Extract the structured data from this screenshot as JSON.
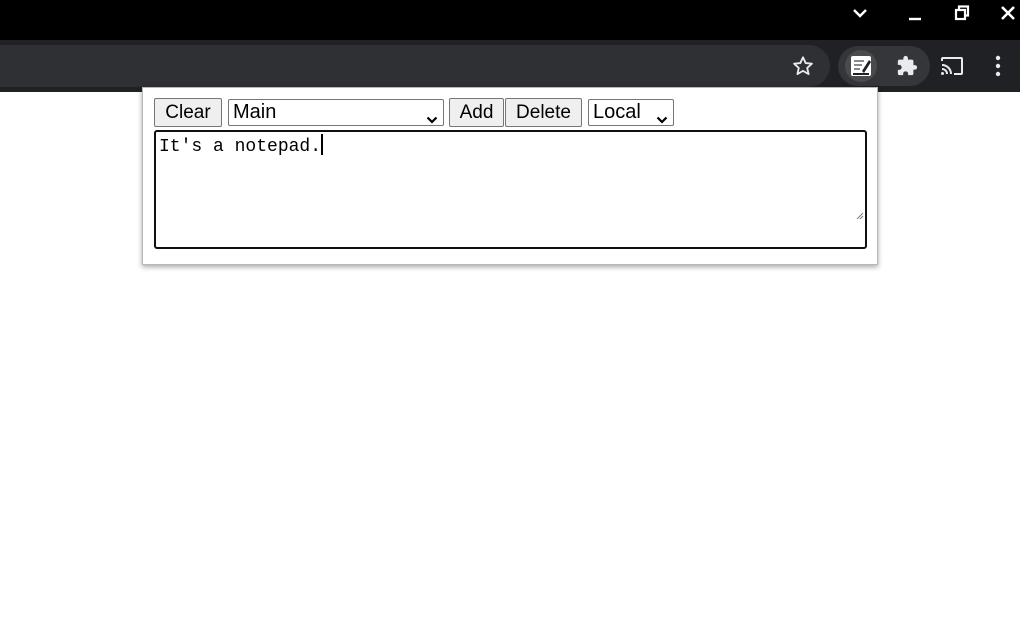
{
  "browser": {
    "titlebar_color": "#000000",
    "toolbar_color": "#202124",
    "icons": [
      "chevron-down-icon",
      "minimize-icon",
      "restore-icon",
      "close-icon",
      "star-icon",
      "notepad-extension-icon",
      "puzzle-icon",
      "cast-icon",
      "more-vert-icon"
    ]
  },
  "popup": {
    "clear_label": "Clear",
    "note_select": {
      "selected": "Main"
    },
    "add_label": "Add",
    "delete_label": "Delete",
    "storage_select": {
      "selected": "Local"
    },
    "notepad_text": "It's a notepad."
  }
}
